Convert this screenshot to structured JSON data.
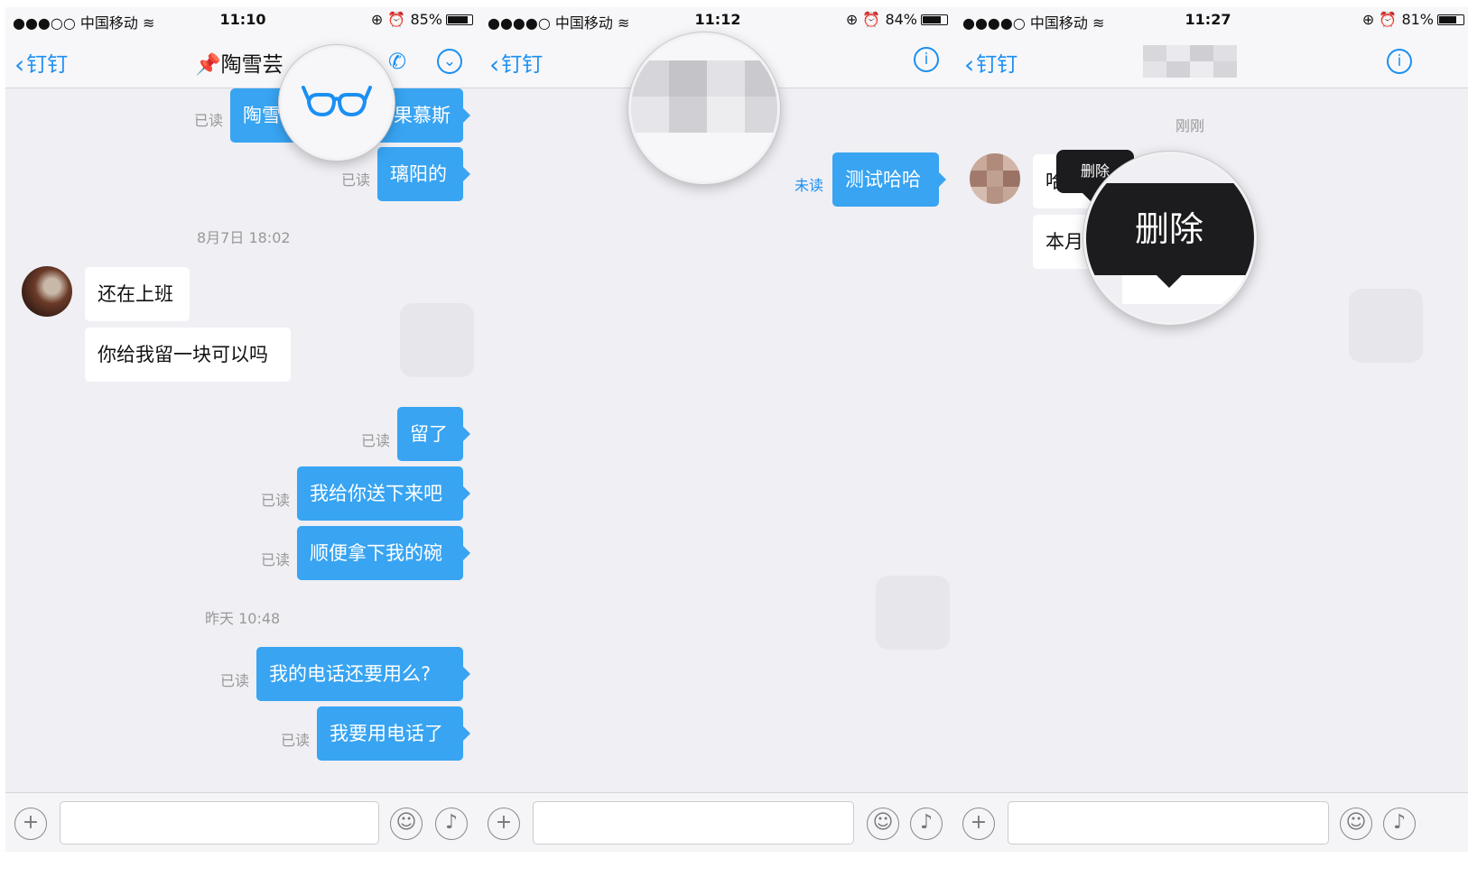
{
  "panels": [
    {
      "status_bar": {
        "carrier": "●●●○○ 中国移动",
        "time": "11:10",
        "battery": "85%"
      },
      "nav": {
        "back_label": "钉钉",
        "title": "陶雪芸"
      },
      "messages": [
        {
          "text": "陶雪",
          "status": "已读"
        },
        {
          "text": "果慕斯"
        },
        {
          "text": "璃阳的",
          "status": "已读"
        },
        {
          "timestamp": "8月7日 18:02"
        },
        {
          "text": "还在上班"
        },
        {
          "text": "你给我留一块可以吗"
        },
        {
          "text": "留了",
          "status": "已读"
        },
        {
          "text": "我给你送下来吧",
          "status": "已读"
        },
        {
          "text": "顺便拿下我的碗",
          "status": "已读"
        },
        {
          "timestamp": "昨天 10:48"
        },
        {
          "text": "我的电话还要用么?",
          "status": "已读"
        },
        {
          "text": "我要用电话了",
          "status": "已读"
        }
      ],
      "magnifier_icon": "glasses-icon"
    },
    {
      "status_bar": {
        "carrier": "●●●●○ 中国移动",
        "time": "11:12",
        "battery": "84%"
      },
      "nav": {
        "back_label": "钉钉"
      },
      "messages": [
        {
          "text": "测试哈哈",
          "status": "未读"
        }
      ]
    },
    {
      "status_bar": {
        "carrier": "●●●●○ 中国移动",
        "time": "11:27",
        "battery": "81%"
      },
      "nav": {
        "back_label": "钉钉"
      },
      "timestamp": "刚刚",
      "messages": [
        {
          "text": "哈"
        },
        {
          "text": "本月"
        }
      ],
      "tooltip_small": "删除",
      "tooltip_large": "删除"
    }
  ],
  "colors": {
    "accent": "#1b8ff2",
    "bubble_out": "#38a4f2",
    "background": "#efeff4"
  }
}
